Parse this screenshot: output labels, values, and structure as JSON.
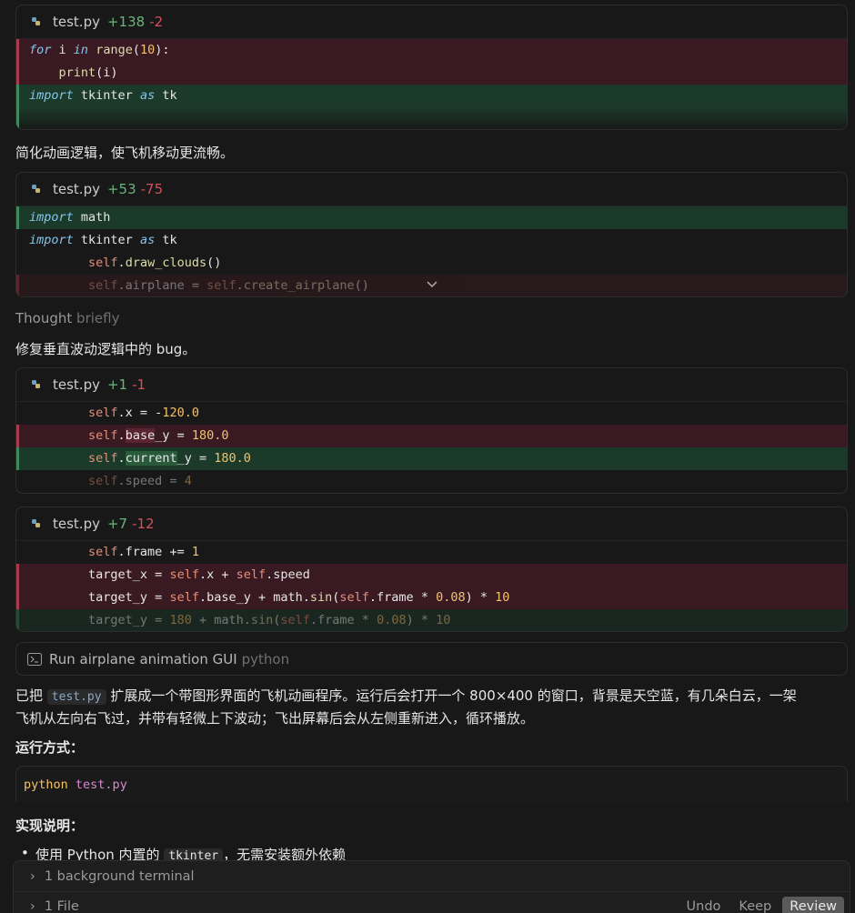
{
  "diff1": {
    "filename": "test.py",
    "added": "+138",
    "removed": "-2"
  },
  "msg1": "简化动画逻辑，使飞机移动更流畅。",
  "diff2": {
    "filename": "test.py",
    "added": "+53",
    "removed": "-75"
  },
  "thought": {
    "label": "Thought",
    "duration": "briefly"
  },
  "msg2": "修复垂直波动逻辑中的 bug。",
  "diff3": {
    "filename": "test.py",
    "added": "+1",
    "removed": "-1"
  },
  "diff4": {
    "filename": "test.py",
    "added": "+7",
    "removed": "-12"
  },
  "terminal": {
    "label": "Run airplane animation GUI",
    "lang": "python"
  },
  "summary": {
    "prefix": "已把",
    "code": "test.py",
    "line1_rest": "扩展成一个带图形界面的飞机动画程序。运行后会打开一个 800×400 的窗口，背景是天空蓝，有几朵白云，一架",
    "line2": "飞机从左向右飞过，并带有轻微上下波动；飞出屏幕后会从左侧重新进入，循环播放。"
  },
  "run_heading": "运行方式：",
  "run_cmd_a": "python",
  "run_cmd_b": "test.py",
  "impl_heading": "实现说明：",
  "bullet1": {
    "prefix": "使用 Python 内置的",
    "code": "tkinter",
    "suffix": "，无需安装额外依赖"
  },
  "bottom": {
    "terminals": "1 background terminal",
    "files": "1 File",
    "undo": "Undo",
    "keep": "Keep",
    "review": "Review"
  }
}
